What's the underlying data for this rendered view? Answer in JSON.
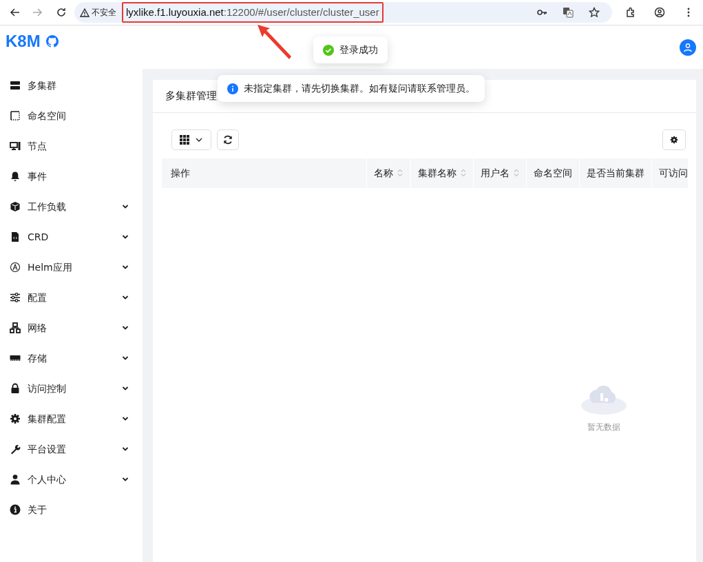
{
  "browser": {
    "nav": [
      {
        "kind": "back",
        "disabled": false
      },
      {
        "kind": "forward",
        "disabled": true
      },
      {
        "kind": "reload",
        "disabled": false
      }
    ],
    "security_label": "不安全",
    "url_host": "lyxlike.f1.luyouxia.net",
    "url_path": ":12200/#/user/cluster/cluster_user"
  },
  "app": {
    "logo": "K8M"
  },
  "sidebar": {
    "items": [
      {
        "label": "多集群",
        "has_submenu": false
      },
      {
        "label": "命名空间",
        "has_submenu": false
      },
      {
        "label": "节点",
        "has_submenu": false
      },
      {
        "label": "事件",
        "has_submenu": false
      },
      {
        "label": "工作负载",
        "has_submenu": true
      },
      {
        "label": "CRD",
        "has_submenu": true
      },
      {
        "label": "Helm应用",
        "has_submenu": true
      },
      {
        "label": "配置",
        "has_submenu": true
      },
      {
        "label": "网络",
        "has_submenu": true
      },
      {
        "label": "存储",
        "has_submenu": true
      },
      {
        "label": "访问控制",
        "has_submenu": true
      },
      {
        "label": "集群配置",
        "has_submenu": true
      },
      {
        "label": "平台设置",
        "has_submenu": true
      },
      {
        "label": "个人中心",
        "has_submenu": true
      },
      {
        "label": "关于",
        "has_submenu": false
      }
    ]
  },
  "page": {
    "title": "多集群管理"
  },
  "table": {
    "columns": [
      {
        "label": "操作",
        "sortable": false
      },
      {
        "label": "名称",
        "sortable": true
      },
      {
        "label": "集群名称",
        "sortable": true
      },
      {
        "label": "用户名",
        "sortable": true
      },
      {
        "label": "命名空间",
        "sortable": false
      },
      {
        "label": "是否当前集群",
        "sortable": false
      },
      {
        "label": "可访问",
        "sortable": false
      }
    ],
    "empty_text": "暂无数据"
  },
  "toasts": [
    {
      "kind": "success",
      "text": "登录成功"
    },
    {
      "kind": "info",
      "text": "未指定集群，请先切换集群。如有疑问请联系管理员。"
    }
  ]
}
